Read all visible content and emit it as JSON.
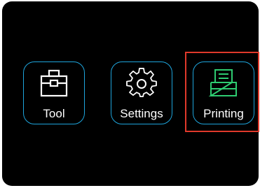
{
  "menu": {
    "items": [
      {
        "label": "Tool",
        "icon": "toolbox-icon"
      },
      {
        "label": "Settings",
        "icon": "gear-icon"
      },
      {
        "label": "Printing",
        "icon": "printer-icon"
      }
    ],
    "selected_index": 2
  },
  "colors": {
    "background": "#000000",
    "tile_border": "#1ea5dc",
    "icon_default": "#ffffff",
    "icon_selected": "#2ecc71",
    "highlight_frame": "#e0392b",
    "label": "#ffffff"
  }
}
